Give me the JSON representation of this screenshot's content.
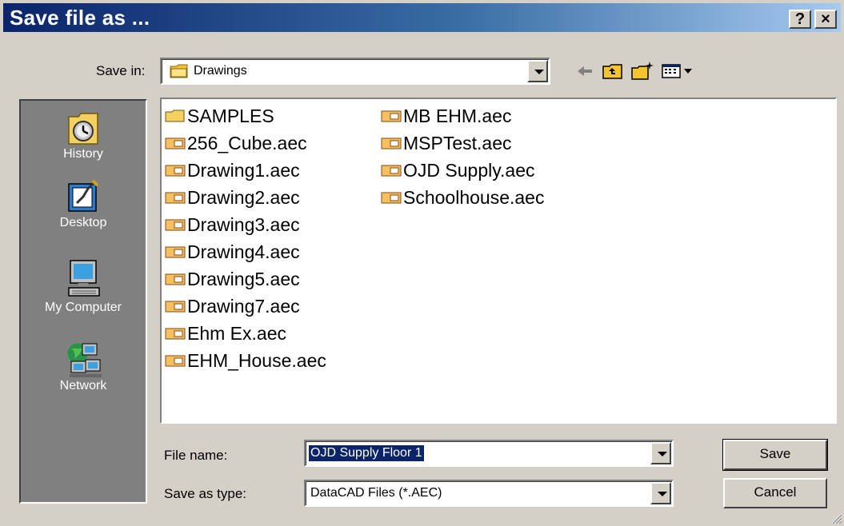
{
  "window": {
    "title": "Save file as ...",
    "help_label": "?",
    "close_label": "×"
  },
  "save_in": {
    "label": "Save in:",
    "value": "Drawings"
  },
  "toolbar": {
    "icons": [
      "back-icon",
      "up-folder-icon",
      "new-folder-icon",
      "view-menu-icon"
    ]
  },
  "places": [
    {
      "label": "History",
      "icon": "history-icon"
    },
    {
      "label": "Desktop",
      "icon": "desktop-icon"
    },
    {
      "label": "My Computer",
      "icon": "my-computer-icon"
    },
    {
      "label": "Network",
      "icon": "network-icon"
    }
  ],
  "files": {
    "column1": [
      "SAMPLES",
      "256_Cube.aec",
      "Drawing1.aec",
      "Drawing2.aec",
      "Drawing3.aec",
      "Drawing4.aec",
      "Drawing5.aec",
      "Drawing7.aec",
      "Ehm Ex.aec",
      "EHM_House.aec"
    ],
    "column2": [
      "MB EHM.aec",
      "MSPTest.aec",
      "OJD Supply.aec",
      "Schoolhouse.aec"
    ]
  },
  "file_name": {
    "label": "File name:",
    "value": "OJD Supply Floor 1"
  },
  "save_as_type": {
    "label": "Save as type:",
    "value": "DataCAD Files (*.AEC)"
  },
  "buttons": {
    "save": "Save",
    "cancel": "Cancel"
  },
  "colors": {
    "title_start": "#0a246a",
    "title_end": "#a6caf0",
    "face": "#d4d0c8",
    "selection": "#0a246a"
  }
}
